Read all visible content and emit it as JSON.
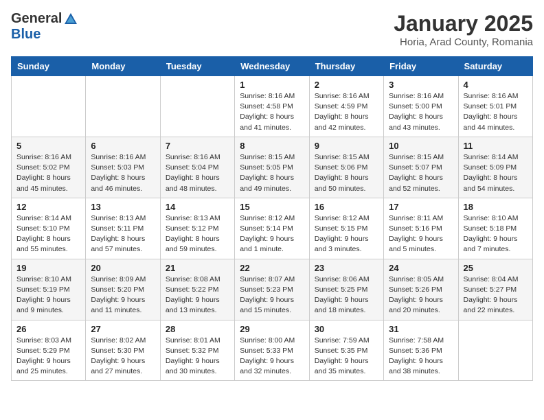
{
  "header": {
    "logo_general": "General",
    "logo_blue": "Blue",
    "month_title": "January 2025",
    "location": "Horia, Arad County, Romania"
  },
  "weekdays": [
    "Sunday",
    "Monday",
    "Tuesday",
    "Wednesday",
    "Thursday",
    "Friday",
    "Saturday"
  ],
  "weeks": [
    [
      {
        "day": "",
        "info": ""
      },
      {
        "day": "",
        "info": ""
      },
      {
        "day": "",
        "info": ""
      },
      {
        "day": "1",
        "info": "Sunrise: 8:16 AM\nSunset: 4:58 PM\nDaylight: 8 hours and 41 minutes."
      },
      {
        "day": "2",
        "info": "Sunrise: 8:16 AM\nSunset: 4:59 PM\nDaylight: 8 hours and 42 minutes."
      },
      {
        "day": "3",
        "info": "Sunrise: 8:16 AM\nSunset: 5:00 PM\nDaylight: 8 hours and 43 minutes."
      },
      {
        "day": "4",
        "info": "Sunrise: 8:16 AM\nSunset: 5:01 PM\nDaylight: 8 hours and 44 minutes."
      }
    ],
    [
      {
        "day": "5",
        "info": "Sunrise: 8:16 AM\nSunset: 5:02 PM\nDaylight: 8 hours and 45 minutes."
      },
      {
        "day": "6",
        "info": "Sunrise: 8:16 AM\nSunset: 5:03 PM\nDaylight: 8 hours and 46 minutes."
      },
      {
        "day": "7",
        "info": "Sunrise: 8:16 AM\nSunset: 5:04 PM\nDaylight: 8 hours and 48 minutes."
      },
      {
        "day": "8",
        "info": "Sunrise: 8:15 AM\nSunset: 5:05 PM\nDaylight: 8 hours and 49 minutes."
      },
      {
        "day": "9",
        "info": "Sunrise: 8:15 AM\nSunset: 5:06 PM\nDaylight: 8 hours and 50 minutes."
      },
      {
        "day": "10",
        "info": "Sunrise: 8:15 AM\nSunset: 5:07 PM\nDaylight: 8 hours and 52 minutes."
      },
      {
        "day": "11",
        "info": "Sunrise: 8:14 AM\nSunset: 5:09 PM\nDaylight: 8 hours and 54 minutes."
      }
    ],
    [
      {
        "day": "12",
        "info": "Sunrise: 8:14 AM\nSunset: 5:10 PM\nDaylight: 8 hours and 55 minutes."
      },
      {
        "day": "13",
        "info": "Sunrise: 8:13 AM\nSunset: 5:11 PM\nDaylight: 8 hours and 57 minutes."
      },
      {
        "day": "14",
        "info": "Sunrise: 8:13 AM\nSunset: 5:12 PM\nDaylight: 8 hours and 59 minutes."
      },
      {
        "day": "15",
        "info": "Sunrise: 8:12 AM\nSunset: 5:14 PM\nDaylight: 9 hours and 1 minute."
      },
      {
        "day": "16",
        "info": "Sunrise: 8:12 AM\nSunset: 5:15 PM\nDaylight: 9 hours and 3 minutes."
      },
      {
        "day": "17",
        "info": "Sunrise: 8:11 AM\nSunset: 5:16 PM\nDaylight: 9 hours and 5 minutes."
      },
      {
        "day": "18",
        "info": "Sunrise: 8:10 AM\nSunset: 5:18 PM\nDaylight: 9 hours and 7 minutes."
      }
    ],
    [
      {
        "day": "19",
        "info": "Sunrise: 8:10 AM\nSunset: 5:19 PM\nDaylight: 9 hours and 9 minutes."
      },
      {
        "day": "20",
        "info": "Sunrise: 8:09 AM\nSunset: 5:20 PM\nDaylight: 9 hours and 11 minutes."
      },
      {
        "day": "21",
        "info": "Sunrise: 8:08 AM\nSunset: 5:22 PM\nDaylight: 9 hours and 13 minutes."
      },
      {
        "day": "22",
        "info": "Sunrise: 8:07 AM\nSunset: 5:23 PM\nDaylight: 9 hours and 15 minutes."
      },
      {
        "day": "23",
        "info": "Sunrise: 8:06 AM\nSunset: 5:25 PM\nDaylight: 9 hours and 18 minutes."
      },
      {
        "day": "24",
        "info": "Sunrise: 8:05 AM\nSunset: 5:26 PM\nDaylight: 9 hours and 20 minutes."
      },
      {
        "day": "25",
        "info": "Sunrise: 8:04 AM\nSunset: 5:27 PM\nDaylight: 9 hours and 22 minutes."
      }
    ],
    [
      {
        "day": "26",
        "info": "Sunrise: 8:03 AM\nSunset: 5:29 PM\nDaylight: 9 hours and 25 minutes."
      },
      {
        "day": "27",
        "info": "Sunrise: 8:02 AM\nSunset: 5:30 PM\nDaylight: 9 hours and 27 minutes."
      },
      {
        "day": "28",
        "info": "Sunrise: 8:01 AM\nSunset: 5:32 PM\nDaylight: 9 hours and 30 minutes."
      },
      {
        "day": "29",
        "info": "Sunrise: 8:00 AM\nSunset: 5:33 PM\nDaylight: 9 hours and 32 minutes."
      },
      {
        "day": "30",
        "info": "Sunrise: 7:59 AM\nSunset: 5:35 PM\nDaylight: 9 hours and 35 minutes."
      },
      {
        "day": "31",
        "info": "Sunrise: 7:58 AM\nSunset: 5:36 PM\nDaylight: 9 hours and 38 minutes."
      },
      {
        "day": "",
        "info": ""
      }
    ]
  ]
}
